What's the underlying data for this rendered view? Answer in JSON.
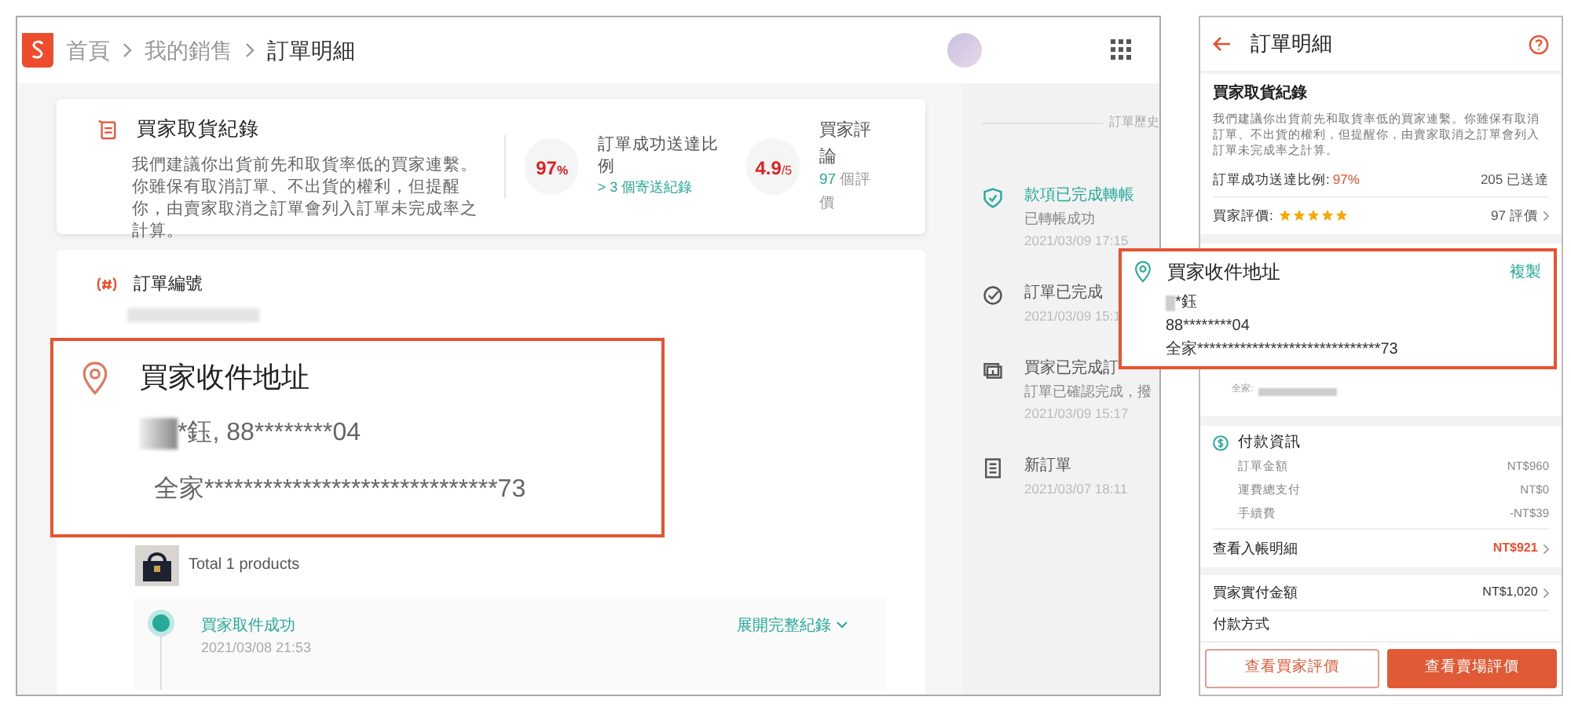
{
  "desktop": {
    "breadcrumb": [
      "首頁",
      "我的銷售",
      "訂單明細"
    ],
    "pickup_record": {
      "title": "買家取貨紀錄",
      "description": "我們建議你出貨前先和取貨率低的買家連繫。你雖保有取消訂單、不出貨的權利，但提醒你，由賣家取消之訂單會列入訂單未完成率之計算。",
      "rate_value": "97",
      "rate_unit": "%",
      "rate_label": "訂單成功送達比例",
      "rate_note": "> 3 個寄送紀錄",
      "rating_value": "4.9",
      "rating_unit": "/5",
      "rating_label": "買家評論",
      "review_count": "97",
      "review_suffix": "個評價"
    },
    "order": {
      "title": "訂單編號",
      "total": "Total 1 products",
      "tracking": {
        "status": "買家取件成功",
        "time": "2021/03/08 21:53",
        "expand": "展開完整紀錄"
      }
    },
    "history": {
      "label": "訂單歷史",
      "events": [
        {
          "kind": "shield",
          "active": true,
          "title": "款項已完成轉帳",
          "subtitle": "已轉帳成功",
          "time": "2021/03/09 17:15"
        },
        {
          "kind": "check",
          "active": false,
          "title": "訂單已完成",
          "time": "2021/03/09 15:1"
        },
        {
          "kind": "transfer",
          "active": false,
          "title": "買家已完成訂",
          "subtitle": "訂單已確認完成，撥",
          "time": "2021/03/09 15:17"
        },
        {
          "kind": "document",
          "active": false,
          "title": "新訂單",
          "time": "2021/03/07 18:11"
        }
      ]
    },
    "address_callout": {
      "title": "買家收件地址",
      "contact": "*鈺, 88********04",
      "address": "全家******************************73"
    }
  },
  "mobile": {
    "title": "訂單明細",
    "pickup_record": {
      "title": "買家取貨紀錄",
      "description": "我們建議你出貨前先和取貨率低的買家連繫。你雖保有取消訂單、不出貨的權利，但提醒你，由賣家取消之訂單會列入訂單未完成率之計算。",
      "rate_label": "訂單成功送達比例:",
      "rate_value": "97%",
      "delivered": "205 已送達",
      "rating_label": "買家評價:",
      "stars": 5,
      "reviews": "97 評價"
    },
    "store_label": "全家:",
    "payment": {
      "title": "付款資訊",
      "rows": [
        {
          "label": "訂單金額",
          "value": "NT$960"
        },
        {
          "label": "運費總支付",
          "value": "NT$0"
        },
        {
          "label": "手續費",
          "value": "-NT$39"
        }
      ]
    },
    "income_link": {
      "label": "查看入帳明細",
      "value": "NT$921"
    },
    "buyer_paid": {
      "label": "買家實付金額",
      "value": "NT$1,020"
    },
    "payment_method": "付款方式",
    "buttons": [
      {
        "label": "查看買家評價",
        "kind": "outline"
      },
      {
        "label": "查看賣場評價",
        "kind": "filled"
      }
    ],
    "address_callout": {
      "title": "買家收件地址",
      "copy": "複製",
      "name": "*鈺",
      "phone": "88********04",
      "address": "全家******************************73"
    }
  }
}
